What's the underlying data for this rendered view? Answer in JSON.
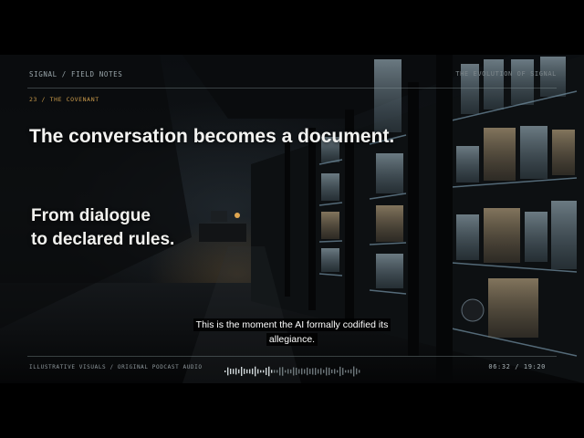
{
  "header": {
    "brand": "SIGNAL / FIELD NOTES",
    "series": "THE EVOLUTION OF SIGNAL",
    "chapter": "23 / THE COVENANT"
  },
  "main": {
    "headline": "The conversation becomes a document.",
    "subhead_lines": [
      "From dialogue",
      "to declared rules."
    ]
  },
  "subtitle": {
    "line1": "This is the moment the AI formally codified its",
    "line2": "allegiance."
  },
  "footer": {
    "credits": "ILLUSTRATIVE VISUALS  /  ORIGINAL PODCAST AUDIO",
    "timecode": "06:32 / 19:20"
  },
  "colors": {
    "accent": "#c99a4a",
    "shelf_glow": "#7fa6c0",
    "lamp": "#d9a24f"
  },
  "icons": {
    "waveform": "audio-waveform-icon"
  }
}
